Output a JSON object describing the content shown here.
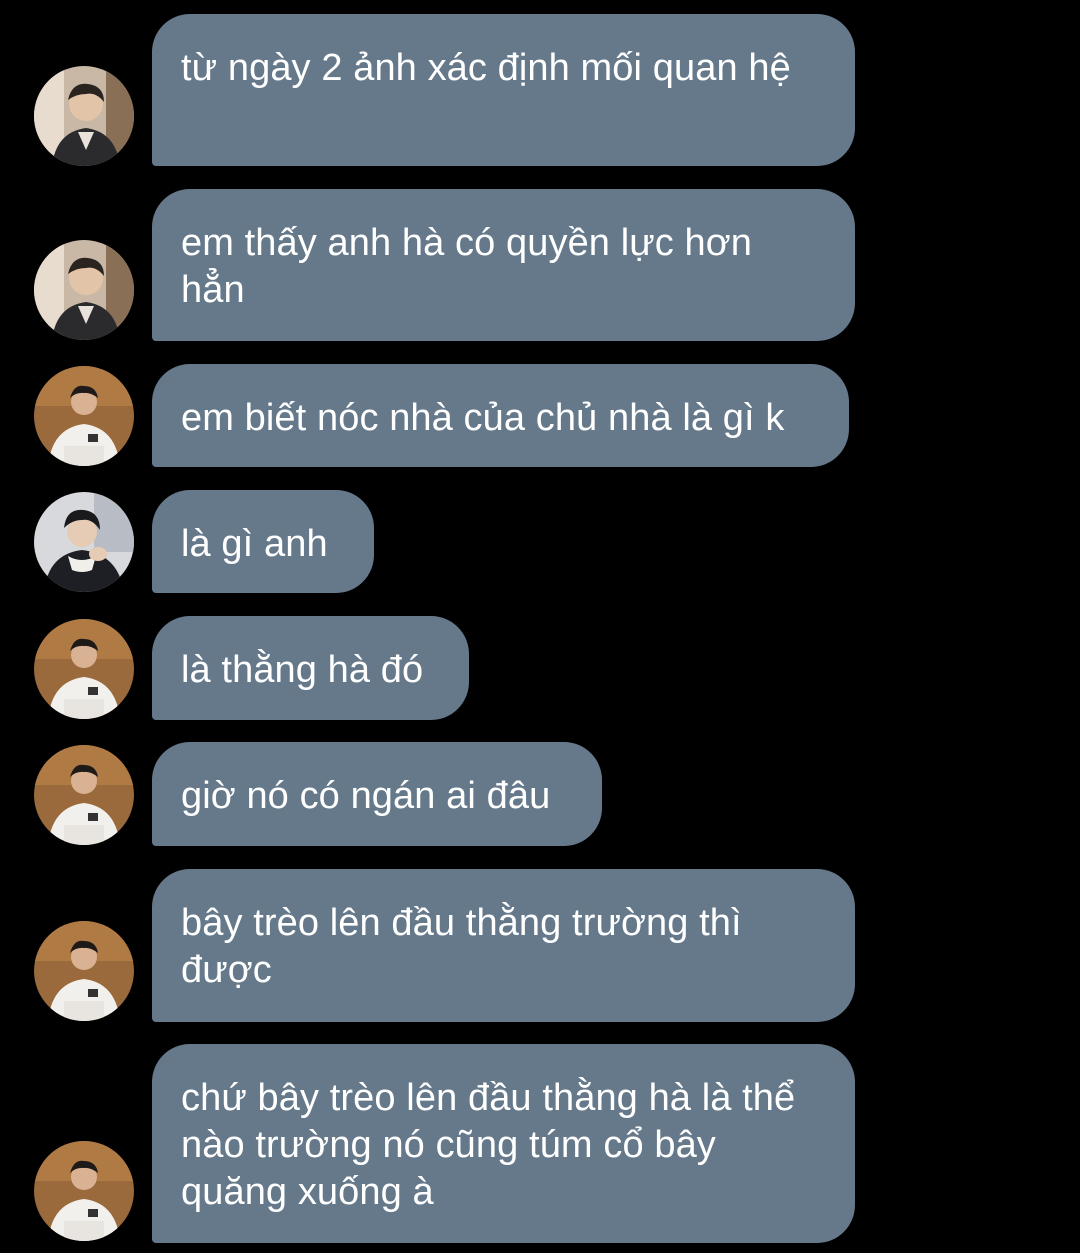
{
  "colors": {
    "background": "#000000",
    "bubble": "#65798b",
    "text": "#ffffff"
  },
  "messages": [
    {
      "sender": "user-a",
      "avatar_icon": "user-avatar-icon",
      "text": "từ ngày 2 ảnh xác định mối quan hệ"
    },
    {
      "sender": "user-a",
      "avatar_icon": "user-avatar-icon",
      "text": "em thấy anh hà có quyền lực hơn hẳn"
    },
    {
      "sender": "user-b",
      "avatar_icon": "user-avatar-icon",
      "text": "em biết nóc nhà của chủ nhà là gì k"
    },
    {
      "sender": "user-c",
      "avatar_icon": "user-avatar-icon",
      "text": "là gì anh"
    },
    {
      "sender": "user-b",
      "avatar_icon": "user-avatar-icon",
      "text": "là thằng hà đó"
    },
    {
      "sender": "user-b",
      "avatar_icon": "user-avatar-icon",
      "text": "giờ nó có ngán ai đâu"
    },
    {
      "sender": "user-b",
      "avatar_icon": "user-avatar-icon",
      "text": "bây trèo lên đầu thằng trường thì được"
    },
    {
      "sender": "user-b",
      "avatar_icon": "user-avatar-icon",
      "text": "chứ bây trèo lên đầu thằng hà là thể nào trường nó cũng túm cổ bây quăng xuống à"
    }
  ]
}
